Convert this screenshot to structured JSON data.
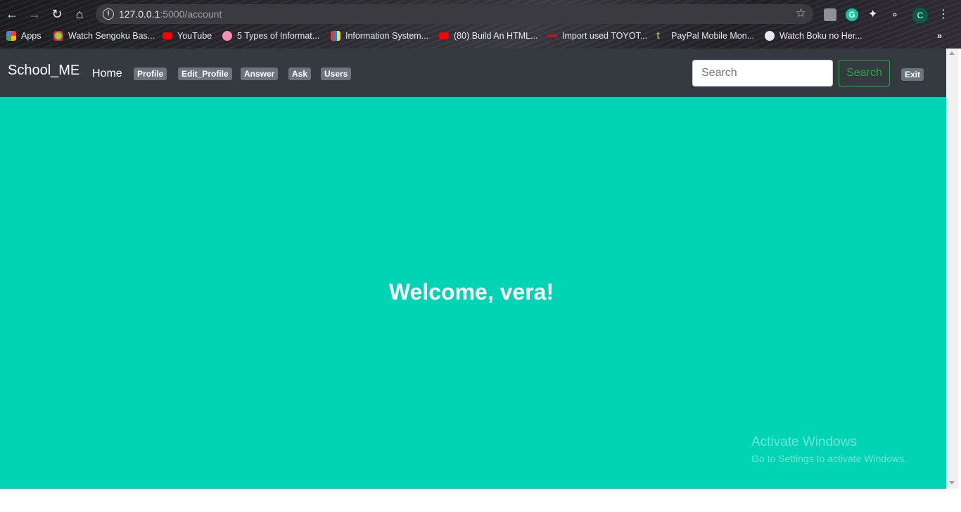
{
  "browser": {
    "url_host": "127.0.0.1",
    "url_path": ":5000/account",
    "profile_initial": "C",
    "bookmarks": [
      {
        "label": "Apps",
        "icon": "apps-grid-icon"
      },
      {
        "label": "Watch Sengoku Bas...",
        "icon": "sengoku-icon"
      },
      {
        "label": "YouTube",
        "icon": "youtube-icon"
      },
      {
        "label": "5 Types of Informat...",
        "icon": "pink-circle-icon"
      },
      {
        "label": "Information System...",
        "icon": "info-system-icon"
      },
      {
        "label": "(80) Build An HTML...",
        "icon": "youtube-icon"
      },
      {
        "label": "Import used TOYOT...",
        "icon": "car-icon"
      },
      {
        "label": "PayPal Mobile Mon...",
        "icon": "t-letter-icon"
      },
      {
        "label": "Watch Boku no Her...",
        "icon": "globe-icon"
      }
    ]
  },
  "navbar": {
    "brand": "School_ME",
    "home": "Home",
    "badges": [
      "Profile",
      "Edit_Profile",
      "Answer",
      "Ask",
      "Users"
    ],
    "search_placeholder": "Search",
    "search_button": "Search",
    "exit": "Exit"
  },
  "main": {
    "welcome": "Welcome, vera!"
  },
  "watermark": {
    "line1": "Activate Windows",
    "line2": "Go to Settings to activate Windows."
  },
  "colors": {
    "navbar_bg": "#343a40",
    "hero_bg": "#00d4b5",
    "badge_bg": "#6c757d",
    "search_outline": "#28a745"
  }
}
